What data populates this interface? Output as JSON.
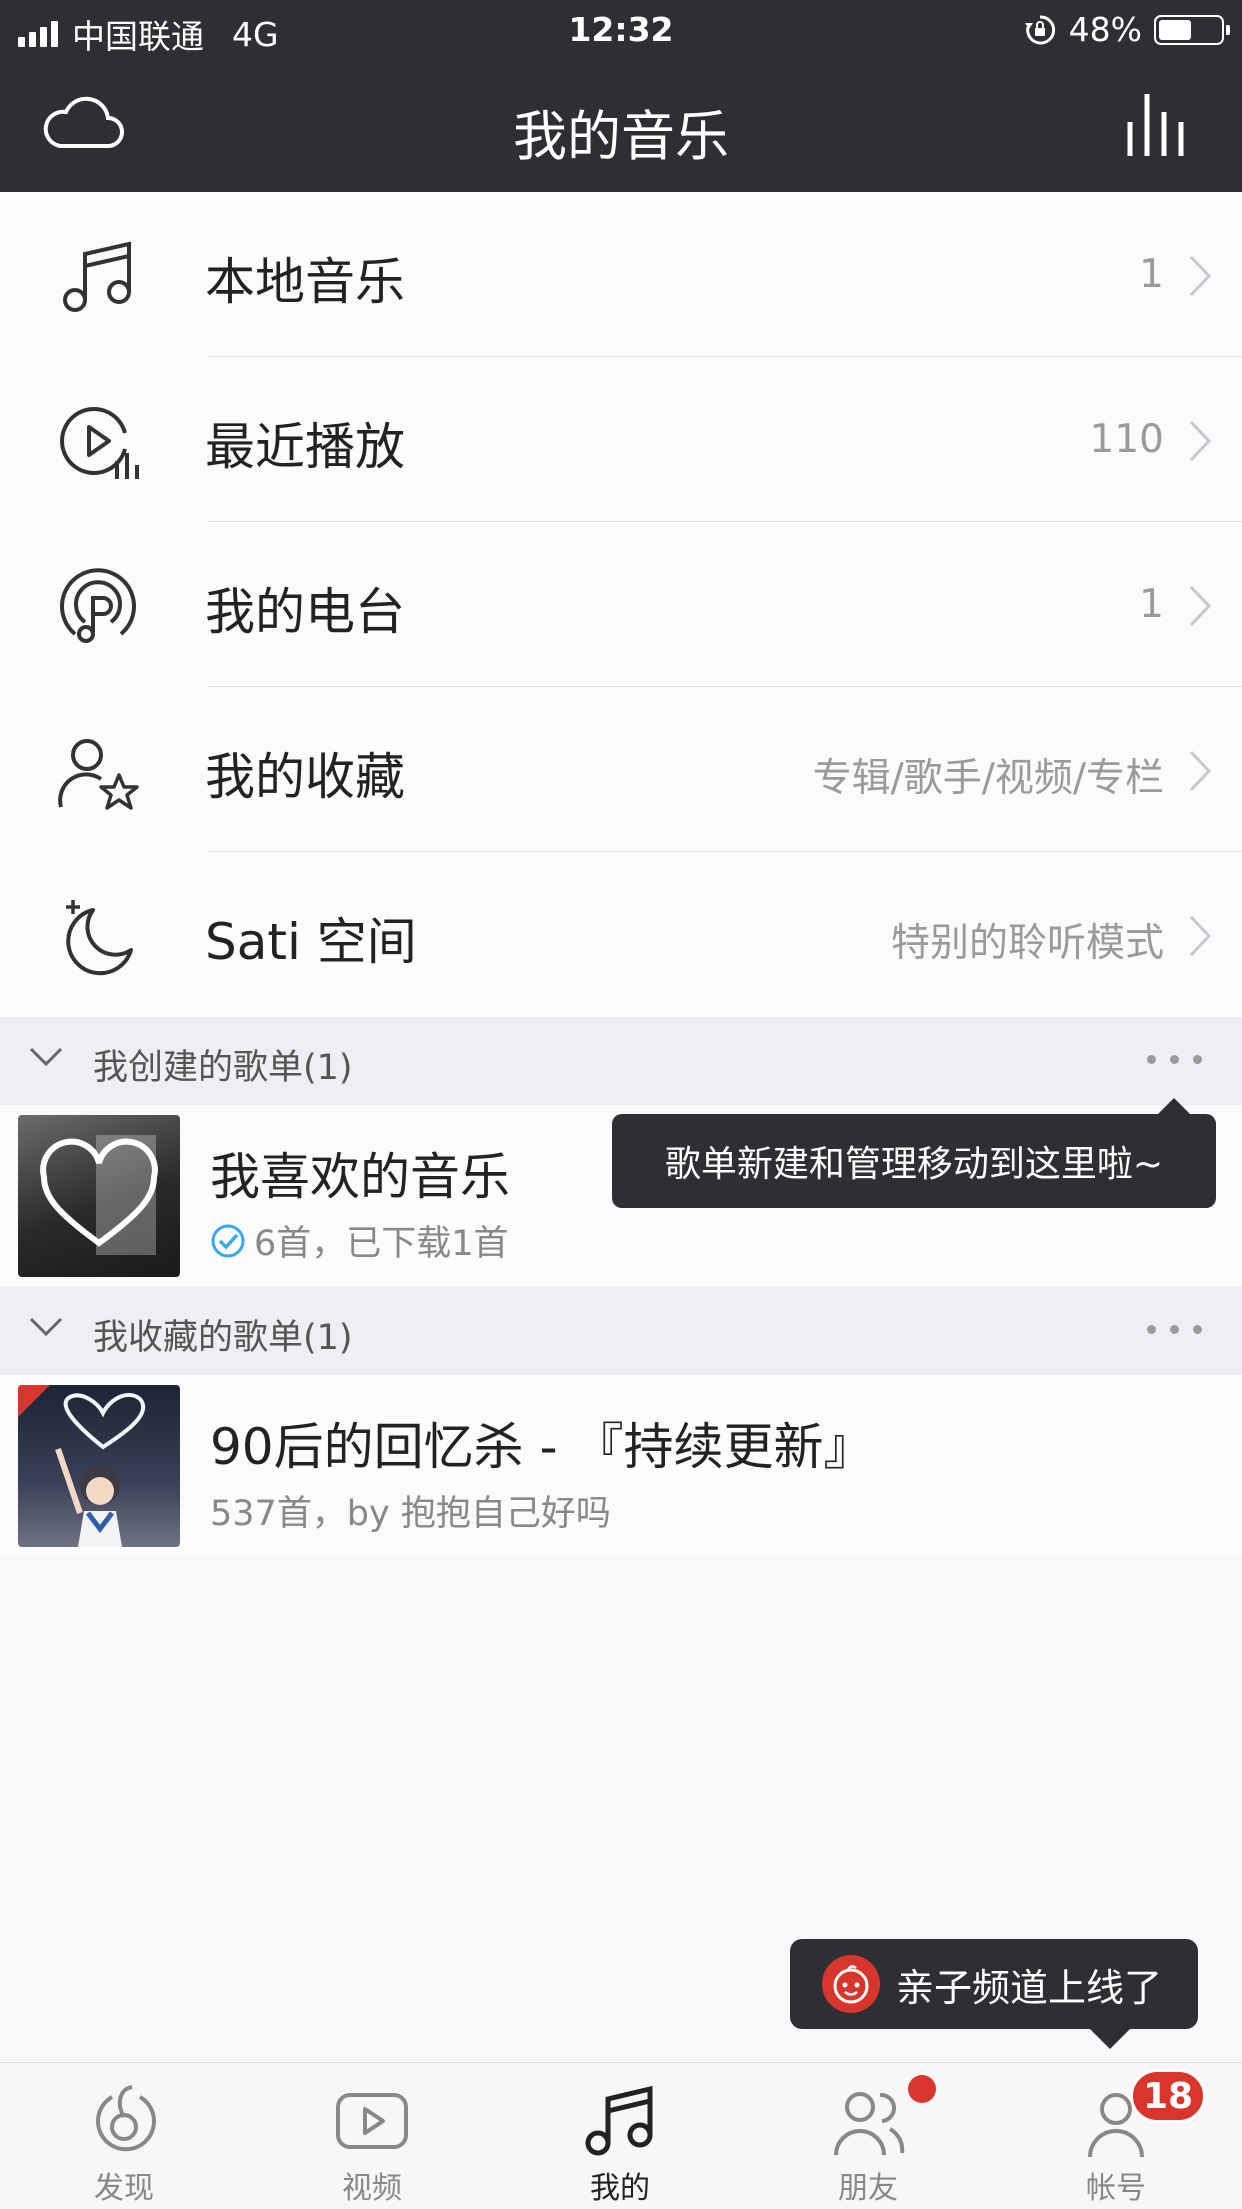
{
  "status_bar": {
    "carrier": "中国联通",
    "network": "4G",
    "time": "12:32",
    "battery": "48%"
  },
  "header": {
    "title": "我的音乐",
    "left_icon": "cloud-icon",
    "right_icon": "equalizer-icon"
  },
  "menu": [
    {
      "label": "本地音乐",
      "value": "1",
      "icon": "music-note-icon"
    },
    {
      "label": "最近播放",
      "value": "110",
      "icon": "recent-play-icon"
    },
    {
      "label": "我的电台",
      "value": "1",
      "icon": "radio-icon"
    },
    {
      "label": "我的收藏",
      "value": "专辑/歌手/视频/专栏",
      "icon": "user-star-icon"
    },
    {
      "label": "Sati 空间",
      "value": "特别的聆听模式",
      "icon": "moon-icon"
    }
  ],
  "created_section": {
    "title": "我创建的歌单(1)",
    "playlists": [
      {
        "name": "我喜欢的音乐",
        "meta": "6首，已下载1首"
      }
    ]
  },
  "tooltip": "歌单新建和管理移动到这里啦~",
  "collected_section": {
    "title": "我收藏的歌单(1)",
    "playlists": [
      {
        "name": "90后的回忆杀 - 『持续更新』",
        "meta": "537首，by 抱抱自己好吗"
      }
    ]
  },
  "promo": "亲子频道上线了",
  "tabs": [
    {
      "label": "发现",
      "icon": "discover-icon"
    },
    {
      "label": "视频",
      "icon": "video-icon"
    },
    {
      "label": "我的",
      "icon": "music-note-icon",
      "active": true
    },
    {
      "label": "朋友",
      "icon": "friends-icon"
    },
    {
      "label": "帐号",
      "icon": "account-icon",
      "badge": "18"
    }
  ],
  "colors": {
    "accent": "#d8352c",
    "bar": "#2d2f33",
    "check": "#3aa8e6"
  }
}
